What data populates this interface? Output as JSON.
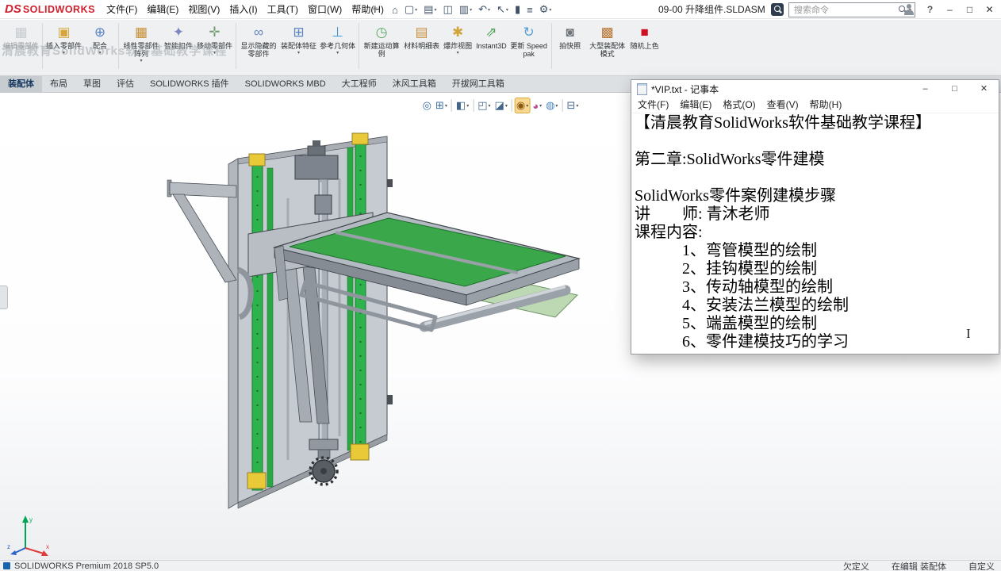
{
  "titlebar": {
    "logo_prefix": "DS",
    "logo_text": "SOLIDWORKS",
    "menus": [
      "文件(F)",
      "编辑(E)",
      "视图(V)",
      "插入(I)",
      "工具(T)",
      "窗口(W)",
      "帮助(H)"
    ],
    "pin_glyph": "✶",
    "tools": [
      {
        "name": "home-icon",
        "glyph": "⌂",
        "caret": false
      },
      {
        "name": "new-document-icon",
        "glyph": "▢",
        "caret": true
      },
      {
        "name": "open-document-icon",
        "glyph": "▤",
        "caret": true
      },
      {
        "name": "save-icon",
        "glyph": "◫",
        "caret": false
      },
      {
        "name": "print-icon",
        "glyph": "▥",
        "caret": true
      },
      {
        "name": "undo-icon",
        "glyph": "↶",
        "caret": true
      },
      {
        "name": "select-cursor-icon",
        "glyph": "↖",
        "caret": true
      },
      {
        "name": "touch-mode-icon",
        "glyph": "▮",
        "caret": false
      },
      {
        "name": "bom-table-icon",
        "glyph": "≡",
        "caret": false
      },
      {
        "name": "options-gear-icon",
        "glyph": "⚙",
        "caret": true
      }
    ],
    "document_title": "09-00 升降组件.SLDASM",
    "search": {
      "placeholder": "搜索命令"
    },
    "window": {
      "help": "?",
      "minimize": "–",
      "maximize": "□",
      "close": "✕"
    }
  },
  "ribbon": {
    "buttons": [
      {
        "name": "edit-component-button",
        "label": "编辑零部件",
        "icon": "▦",
        "color": "#9aa0a8",
        "disabled": true
      },
      {
        "name": "ribbon-separator",
        "sep": true
      },
      {
        "name": "insert-components-button",
        "label": "插入零部件",
        "icon": "▣",
        "color": "#d9a53a",
        "caret": true
      },
      {
        "name": "mate-button",
        "label": "配合",
        "icon": "⊕",
        "color": "#5b86c5",
        "caret": true
      },
      {
        "name": "ribbon-separator",
        "sep": true
      },
      {
        "name": "linear-component-pattern-button",
        "label": "线性零部件阵列",
        "icon": "▦",
        "color": "#c78f35",
        "caret": true
      },
      {
        "name": "smart-fasteners-button",
        "label": "智能扣件",
        "icon": "✦",
        "color": "#7d88bf"
      },
      {
        "name": "move-component-button",
        "label": "移动零部件",
        "icon": "✛",
        "color": "#6f9a6f",
        "caret": true
      },
      {
        "name": "ribbon-separator",
        "sep": true
      },
      {
        "name": "show-hidden-components-button",
        "label": "显示隐藏的零部件",
        "icon": "∞",
        "color": "#6a87b8"
      },
      {
        "name": "assembly-features-button",
        "label": "装配体特征",
        "icon": "⊞",
        "color": "#5e86c2",
        "caret": true
      },
      {
        "name": "reference-geometry-button",
        "label": "参考几何体",
        "icon": "⊥",
        "color": "#3f9ad0",
        "caret": true
      },
      {
        "name": "ribbon-separator",
        "sep": true
      },
      {
        "name": "new-motion-study-button",
        "label": "新建运动算例",
        "icon": "◷",
        "color": "#5aa662"
      },
      {
        "name": "bill-of-materials-button",
        "label": "材料明细表",
        "icon": "▤",
        "color": "#c98f3e"
      },
      {
        "name": "exploded-view-button",
        "label": "爆炸视图",
        "icon": "✱",
        "color": "#d0a63c",
        "caret": true
      },
      {
        "name": "instant3d-button",
        "label": "Instant3D",
        "icon": "⇗",
        "color": "#4aa24f"
      },
      {
        "name": "update-speedpak-button",
        "label": "更新 Speedpak",
        "icon": "↻",
        "color": "#5aa0d0"
      },
      {
        "name": "ribbon-separator",
        "sep": true
      },
      {
        "name": "take-snapshot-button",
        "label": "拍快照",
        "icon": "◙",
        "color": "#6f747b"
      },
      {
        "name": "large-assembly-mode-button",
        "label": "大型装配体模式",
        "icon": "▩",
        "color": "#b8742f"
      },
      {
        "name": "random-color-button",
        "label": "随机上色",
        "icon": "■",
        "color": "#cf1020"
      }
    ]
  },
  "tabs": {
    "items": [
      {
        "name": "tab-assembly",
        "label": "装配体",
        "active": true
      },
      {
        "name": "tab-layout",
        "label": "布局"
      },
      {
        "name": "tab-sketch",
        "label": "草图"
      },
      {
        "name": "tab-evaluate",
        "label": "评估"
      },
      {
        "name": "tab-solidworks-addins",
        "label": "SOLIDWORKS 插件"
      },
      {
        "name": "tab-solidworks-mbd",
        "label": "SOLIDWORKS MBD"
      },
      {
        "name": "tab-dagongchengshi",
        "label": "大工程师"
      },
      {
        "name": "tab-mufeng-toolbox",
        "label": "沐风工具箱"
      },
      {
        "name": "tab-kaibawang-toolbox",
        "label": "开拔网工具箱"
      }
    ]
  },
  "viewport": {
    "watermark": "清晨教育SolidWorks软件基础教学课程",
    "headsup": [
      {
        "name": "zoom-fit-icon",
        "glyph": "◎",
        "color": "#3c6f9f",
        "caret": false
      },
      {
        "name": "zoom-to-area-icon",
        "glyph": "⊞",
        "color": "#3c6f9f",
        "caret": true
      },
      {
        "name": "hud-separator",
        "sep": true
      },
      {
        "name": "section-view-icon",
        "glyph": "◧",
        "color": "#44658a",
        "caret": true
      },
      {
        "name": "hud-separator",
        "sep": true
      },
      {
        "name": "view-orientation-icon",
        "glyph": "◰",
        "color": "#44658a",
        "caret": true
      },
      {
        "name": "display-style-icon",
        "glyph": "◪",
        "color": "#44658a",
        "caret": true
      },
      {
        "name": "hud-separator",
        "sep": true
      },
      {
        "name": "hide-show-items-icon",
        "glyph": "◉",
        "color": "#8a5a10",
        "caret": true,
        "active": true
      },
      {
        "name": "edit-appearance-icon",
        "glyph": "◕",
        "color": "#b84a98",
        "caret": true
      },
      {
        "name": "apply-scene-icon",
        "glyph": "◍",
        "color": "#4a86c0",
        "caret": true
      },
      {
        "name": "hud-separator",
        "sep": true
      },
      {
        "name": "view-settings-icon",
        "glyph": "⊟",
        "color": "#44658a",
        "caret": true
      }
    ]
  },
  "notepad": {
    "title": "*VIP.txt - 记事本",
    "menus": [
      "文件(F)",
      "编辑(E)",
      "格式(O)",
      "查看(V)",
      "帮助(H)"
    ],
    "window": {
      "minimize": "–",
      "maximize": "□",
      "close": "✕"
    },
    "lines": [
      "【清晨教育SolidWorks软件基础教学课程】",
      "",
      "第二章:SolidWorks零件建模",
      "",
      "SolidWorks零件案例建模步骤",
      "讲　　师: 青沐老师",
      "课程内容: ",
      "　　　1、弯管模型的绘制",
      "　　　2、挂钩模型的绘制",
      "　　　3、传动轴模型的绘制",
      "　　　4、安装法兰模型的绘制",
      "　　　5、端盖模型的绘制",
      "　　　6、零件建模技巧的学习"
    ]
  },
  "statusbar": {
    "left": "SOLIDWORKS Premium 2018 SP5.0",
    "right": [
      "欠定义",
      "在编辑 装配体",
      "自定义"
    ]
  },
  "colors": {
    "rail_green": "#2eb24b",
    "end_block_yellow": "#e9c937",
    "table_green": "#3aa84a",
    "random_color_red": "#cf1020"
  }
}
